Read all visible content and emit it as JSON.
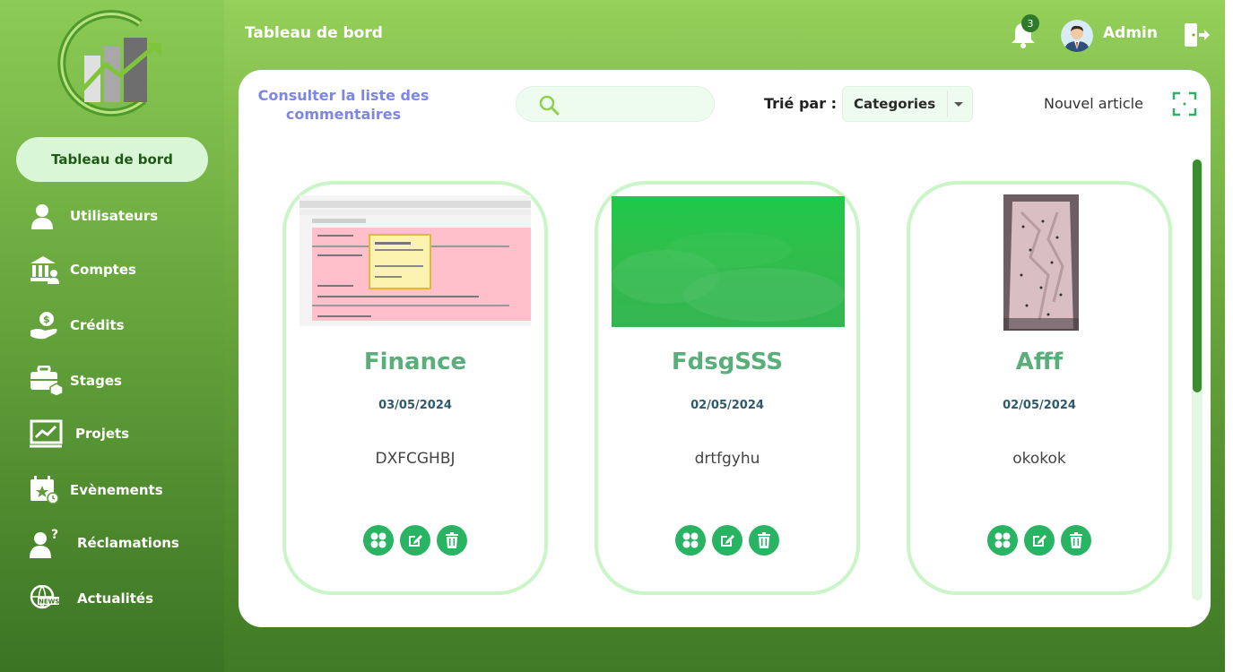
{
  "header": {
    "title": "Tableau de bord",
    "notification_count": "3",
    "user_name": "Admin"
  },
  "sidebar": {
    "active_label": "Tableau de bord",
    "items": [
      {
        "label": "Utilisateurs",
        "icon": "user-icon"
      },
      {
        "label": "Comptes",
        "icon": "bank-icon"
      },
      {
        "label": "Crédits",
        "icon": "money-hand-icon"
      },
      {
        "label": "Stages",
        "icon": "briefcase-icon"
      },
      {
        "label": "Projets",
        "icon": "chart-board-icon"
      },
      {
        "label": "Evènements",
        "icon": "calendar-star-icon"
      },
      {
        "label": "Réclamations",
        "icon": "user-question-icon"
      },
      {
        "label": "Actualités",
        "icon": "news-globe-icon"
      }
    ]
  },
  "toolbar": {
    "comments_link": "Consulter la liste des commentaires",
    "search_placeholder": "",
    "sort_label": "Trié par :",
    "sort_value": "Categories",
    "new_article": "Nouvel article"
  },
  "articles": [
    {
      "title": "Finance",
      "date": "03/05/2024",
      "description": "DXFCGHBJ",
      "image": "screenshot-thumbnail"
    },
    {
      "title": "FdsgSSS",
      "date": "02/05/2024",
      "description": "drtfgyhu",
      "image": "green-texture"
    },
    {
      "title": "Afff",
      "date": "02/05/2024",
      "description": "okokok",
      "image": "pajama-photo"
    }
  ],
  "colors": {
    "accent_green": "#28b463",
    "card_border": "#c9f5c7",
    "link_purple": "#7d86e0",
    "title_green": "#5aae7a"
  }
}
